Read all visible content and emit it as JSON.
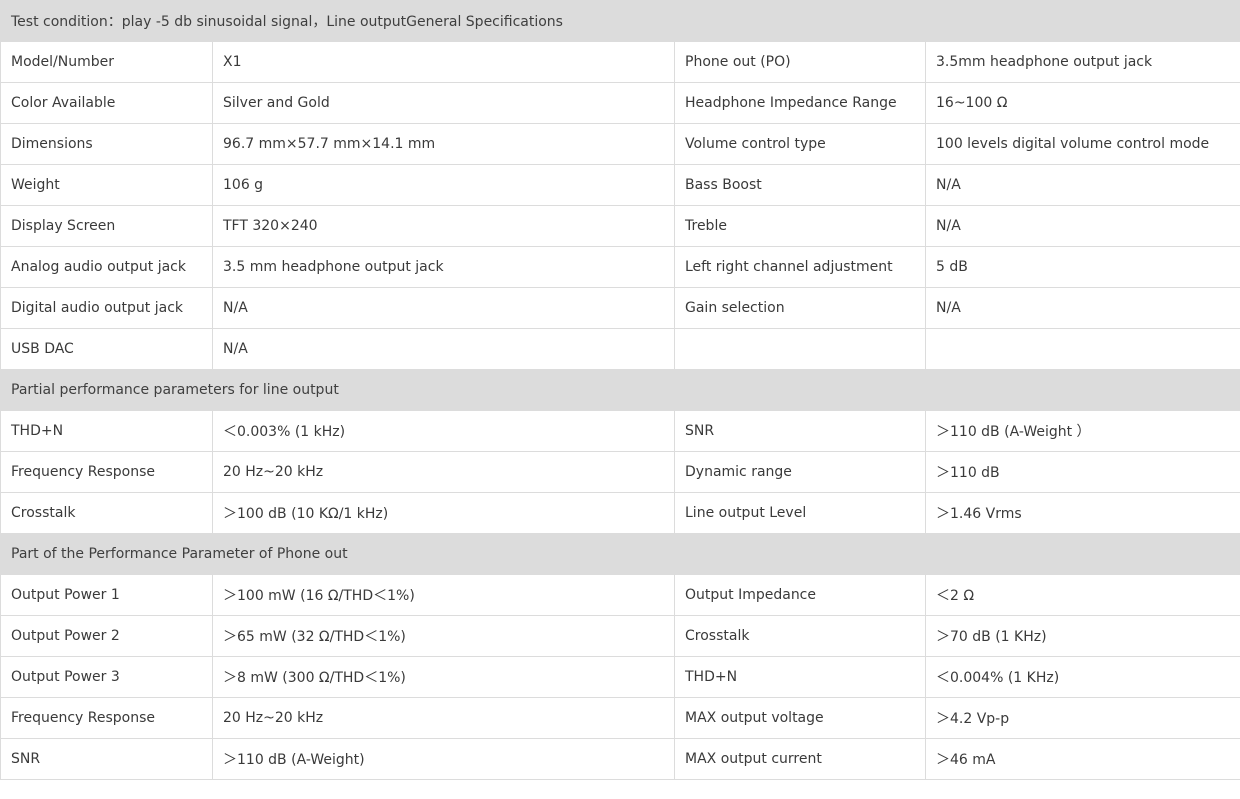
{
  "sections": [
    {
      "title": "Test condition：play -5 db sinusoidal signal，Line outputGeneral Specifications",
      "rows": [
        [
          "Model/Number",
          "X1",
          "Phone out (PO)",
          "3.5mm headphone output jack"
        ],
        [
          "Color Available",
          "Silver and Gold",
          "Headphone Impedance Range",
          "16~100 Ω"
        ],
        [
          "Dimensions",
          "96.7 mm×57.7 mm×14.1 mm",
          "Volume control type",
          "100 levels digital volume control mode"
        ],
        [
          "Weight",
          "106 g",
          "Bass Boost",
          "N/A"
        ],
        [
          "Display Screen",
          "TFT 320×240",
          "Treble",
          "N/A"
        ],
        [
          "Analog audio output jack",
          "3.5 mm headphone output jack",
          "Left  right channel adjustment",
          "5 dB"
        ],
        [
          "Digital audio output jack",
          "N/A",
          "Gain selection",
          "N/A"
        ],
        [
          "USB DAC",
          "N/A",
          "",
          ""
        ]
      ]
    },
    {
      "title": "Partial performance parameters for line output",
      "rows": [
        [
          "THD+N",
          "＜0.003% (1 kHz)",
          "SNR",
          "＞110 dB (A-Weight ）"
        ],
        [
          "Frequency Response",
          "20 Hz~20 kHz",
          "Dynamic range",
          "＞110 dB"
        ],
        [
          "Crosstalk",
          "＞100 dB (10 KΩ/1 kHz)",
          "Line output Level",
          "＞1.46 Vrms"
        ]
      ]
    },
    {
      "title": "Part of the Performance Parameter of Phone out",
      "rows": [
        [
          "Output Power 1",
          "＞100 mW (16 Ω/THD＜1%)",
          "Output Impedance",
          "＜2 Ω"
        ],
        [
          "Output Power 2",
          "＞65 mW (32 Ω/THD＜1%)",
          "Crosstalk",
          "＞70 dB (1 KHz)"
        ],
        [
          "Output Power 3",
          "＞8 mW (300 Ω/THD＜1%)",
          "THD+N",
          "＜0.004% (1 KHz)"
        ],
        [
          "Frequency Response",
          "20 Hz~20 kHz",
          "MAX output voltage",
          "＞4.2 Vp-p"
        ],
        [
          "SNR",
          "＞110 dB (A-Weight)",
          "MAX output current",
          "＞46 mA"
        ]
      ]
    }
  ]
}
